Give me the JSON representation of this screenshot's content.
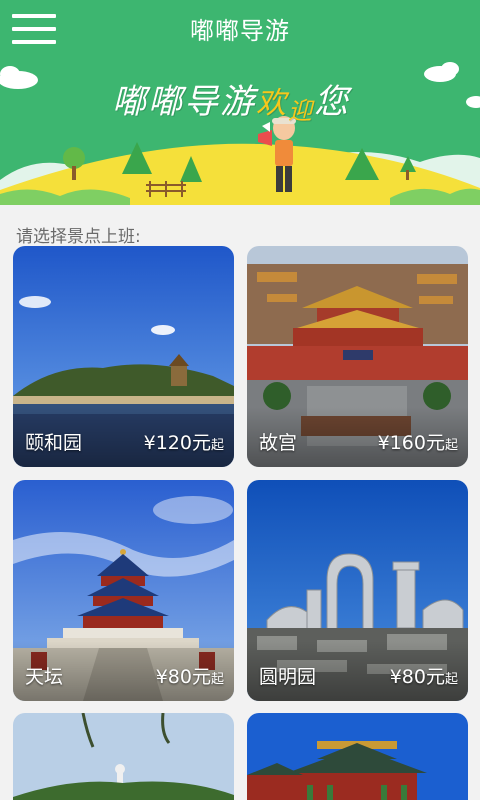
{
  "app": {
    "title": "嘟嘟导游",
    "menu_icon": "menu-icon"
  },
  "banner": {
    "slogan_main": "嘟嘟导游",
    "slogan_accent1": "欢",
    "slogan_accent2": "迎",
    "slogan_accent3": "您"
  },
  "section_label": "请选择景点上班:",
  "spots": [
    {
      "name": "颐和园",
      "price": "¥120元",
      "suffix": "起"
    },
    {
      "name": "故宫",
      "price": "¥160元",
      "suffix": "起"
    },
    {
      "name": "天坛",
      "price": "¥80元",
      "suffix": "起"
    },
    {
      "name": "圆明园",
      "price": "¥80元",
      "suffix": "起"
    }
  ],
  "colors": {
    "brand_green": "#3db670",
    "banner_yellow": "#f5e03a"
  }
}
